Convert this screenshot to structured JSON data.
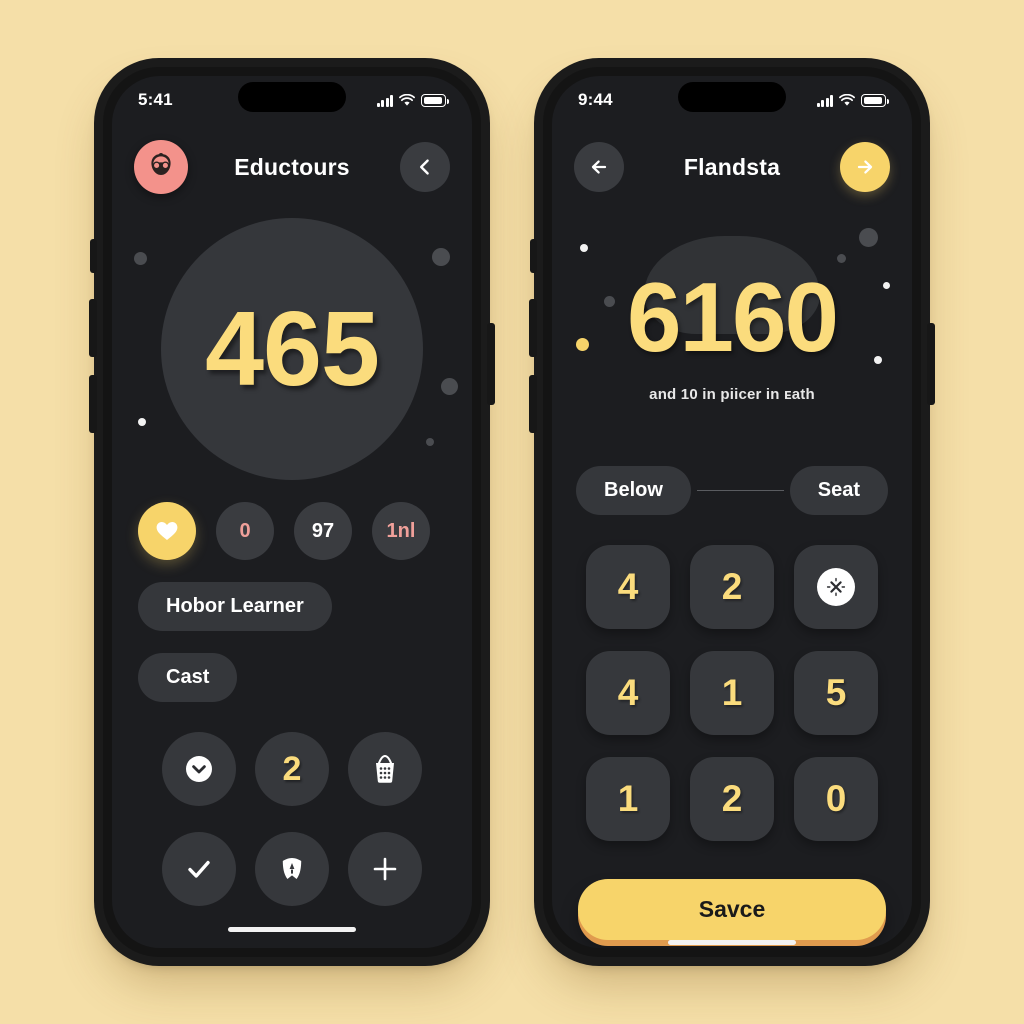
{
  "background_color": "#f5dfa8",
  "accent_color": "#f7d46a",
  "number_color": "#fbdc7d",
  "pink_color": "#f0a09a",
  "surface_color": "#1c1d20",
  "left_phone": {
    "status": {
      "time": "5:41",
      "signal_icon": "signal-bars-icon",
      "wifi_icon": "wifi-icon",
      "battery_icon": "battery-icon"
    },
    "header": {
      "avatar_icon": "avatar-bearded-face-icon",
      "title": "Eductours",
      "back_icon": "chevron-left-icon"
    },
    "hero": {
      "value": "465"
    },
    "chips": [
      {
        "name": "favorite",
        "label": "",
        "icon": "heart-icon",
        "style": "accent"
      },
      {
        "name": "count-zero",
        "label": "0",
        "style": "pink"
      },
      {
        "name": "count-97",
        "label": "97",
        "style": "plain"
      },
      {
        "name": "count-1nl",
        "label": "1nl",
        "style": "pink"
      }
    ],
    "pills": [
      {
        "name": "hobor-learner",
        "label": "Hobor Learner"
      },
      {
        "name": "cast",
        "label": "Cast"
      }
    ],
    "grid": [
      {
        "name": "chevron-down",
        "icon": "chevron-down-circle-icon",
        "label": ""
      },
      {
        "name": "count-two",
        "icon": "",
        "label": "2"
      },
      {
        "name": "basket",
        "icon": "basket-icon",
        "label": ""
      },
      {
        "name": "check",
        "icon": "check-icon",
        "label": ""
      },
      {
        "name": "badge",
        "icon": "badge-shield-icon",
        "label": ""
      },
      {
        "name": "add",
        "icon": "plus-icon",
        "label": ""
      }
    ]
  },
  "right_phone": {
    "status": {
      "time": "9:44",
      "signal_icon": "signal-bars-icon",
      "wifi_icon": "wifi-icon",
      "battery_icon": "battery-icon"
    },
    "header": {
      "back_icon": "arrow-left-icon",
      "title": "Flandsta",
      "next_icon": "arrow-right-icon"
    },
    "hero": {
      "value": "6160",
      "subtitle": "and 10 in piicer in ᴇath"
    },
    "tabs": [
      {
        "name": "below",
        "label": "Below"
      },
      {
        "name": "seat",
        "label": "Seat"
      }
    ],
    "keypad": [
      {
        "name": "key-4a",
        "label": "4",
        "type": "digit"
      },
      {
        "name": "key-2a",
        "label": "2",
        "type": "digit"
      },
      {
        "name": "key-delete",
        "label": "",
        "type": "delete",
        "icon": "close-x-circle-icon"
      },
      {
        "name": "key-4b",
        "label": "4",
        "type": "digit"
      },
      {
        "name": "key-1a",
        "label": "1",
        "type": "digit"
      },
      {
        "name": "key-5",
        "label": "5",
        "type": "digit"
      },
      {
        "name": "key-1b",
        "label": "1",
        "type": "digit"
      },
      {
        "name": "key-2b",
        "label": "2",
        "type": "digit"
      },
      {
        "name": "key-0",
        "label": "0",
        "type": "digit"
      }
    ],
    "save_label": "Savce"
  }
}
